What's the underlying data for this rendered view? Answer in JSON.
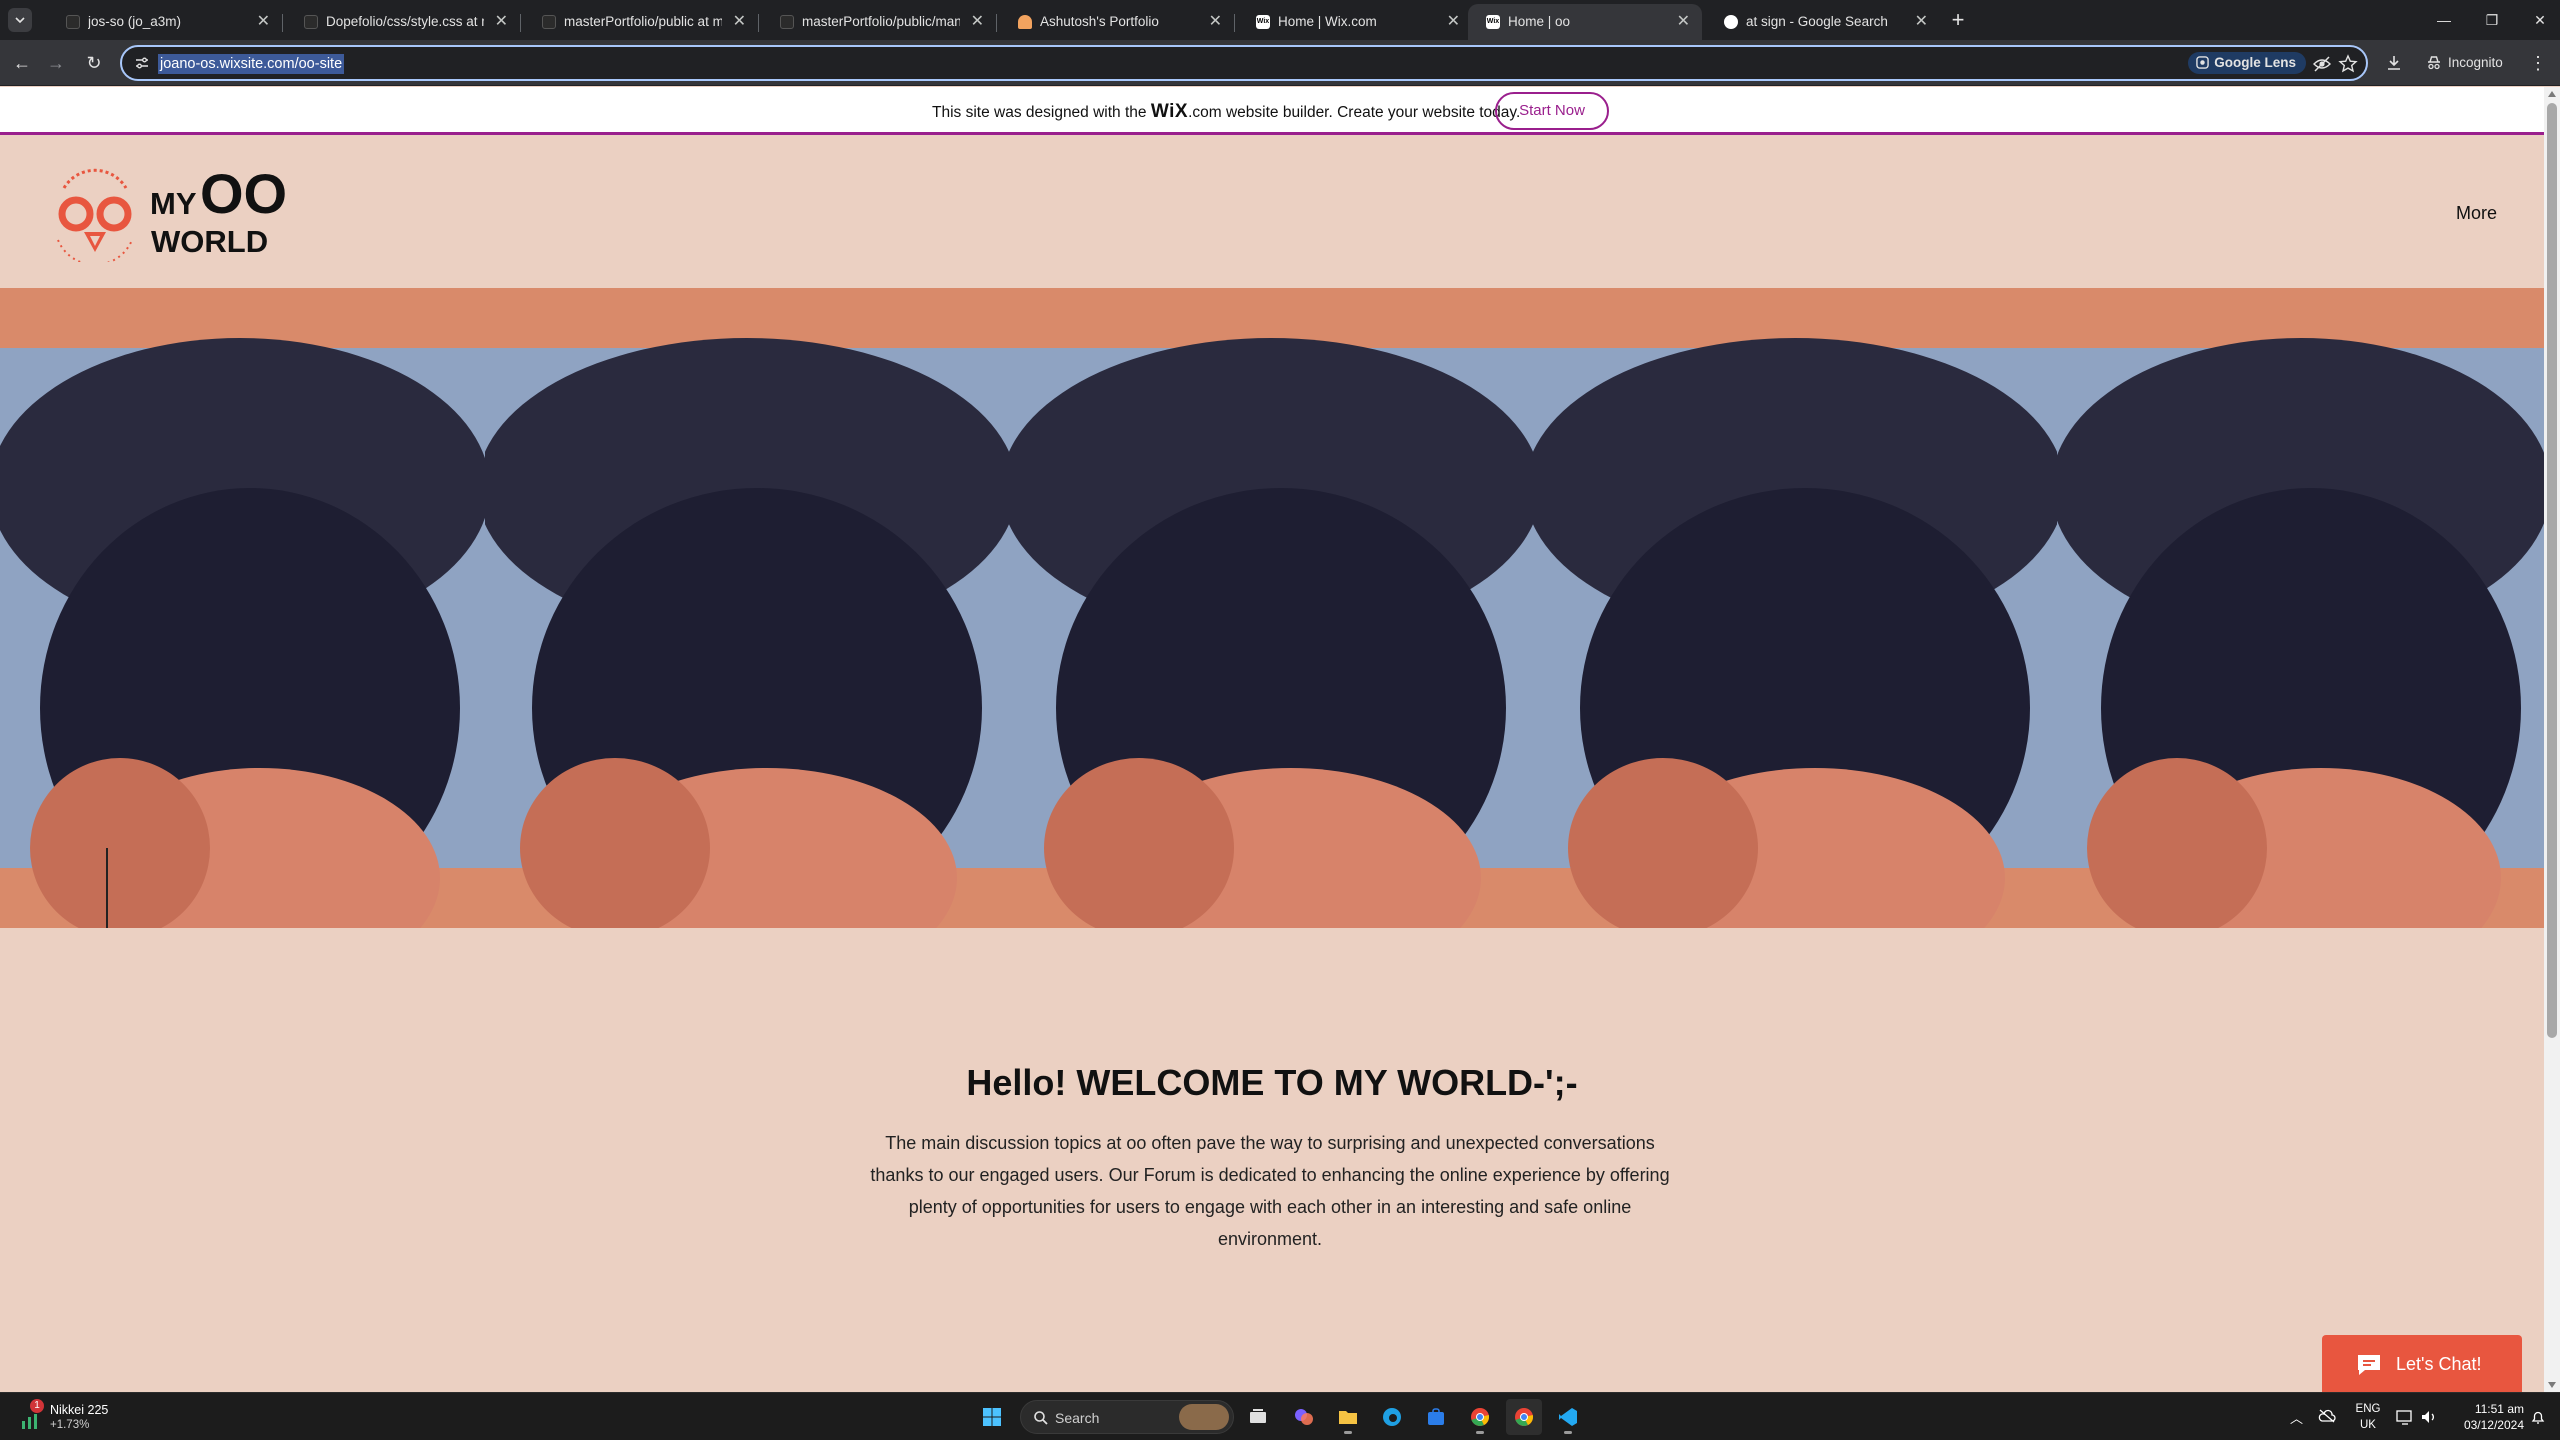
{
  "browser": {
    "tabs": [
      {
        "title": "jos-so (jo_a3m)",
        "favicon_color": "#2b2b2b"
      },
      {
        "title": "Dopefolio/css/style.css at main",
        "favicon_color": "#2b2b2b"
      },
      {
        "title": "masterPortfolio/public at master",
        "favicon_color": "#2b2b2b"
      },
      {
        "title": "masterPortfolio/public/manifest",
        "favicon_color": "#2b2b2b"
      },
      {
        "title": "Ashutosh's Portfolio",
        "favicon_color": "#f2a35f"
      },
      {
        "title": "Home | Wix.com",
        "favicon_color": "#ffffff"
      },
      {
        "title": "Home | oo",
        "favicon_color": "#ffffff"
      },
      {
        "title": "at sign - Google Search",
        "favicon_color": "#ffffff"
      }
    ],
    "active_tab_index": 6,
    "new_tab_label": "+",
    "url": "joano-os.wixsite.com/oo-site",
    "lens_label": "Google Lens",
    "incognito_label": "Incognito"
  },
  "wix_banner": {
    "text_before": "This site was designed with the ",
    "brand": "WiX",
    "text_after": ".com website builder. Create your website today.",
    "cta": "Start Now",
    "accent": "#9a1f8d"
  },
  "site": {
    "logo": {
      "my": "MY",
      "oo": "OO",
      "world": "WORLD"
    },
    "nav_more": "More",
    "welcome_title": "Hello! WELCOME TO MY WORLD-';-",
    "intro": "The main discussion topics at oo often pave the way to surprising and unexpected conversations thanks to our engaged users. Our Forum is dedicated to enhancing the online experience by offering plenty of opportunities for users to engage with each other in an interesting and safe online environment.",
    "chat_label": "Let's Chat!",
    "background": "#ebd0c2",
    "chat_color": "#e8563f"
  },
  "taskbar": {
    "widget_label": "Nikkei 225",
    "widget_change": "+1.73%",
    "widget_badge": "1",
    "search_placeholder": "Search",
    "lang_line1": "ENG",
    "lang_line2": "UK",
    "time": "11:51 am",
    "date": "03/12/2024"
  }
}
